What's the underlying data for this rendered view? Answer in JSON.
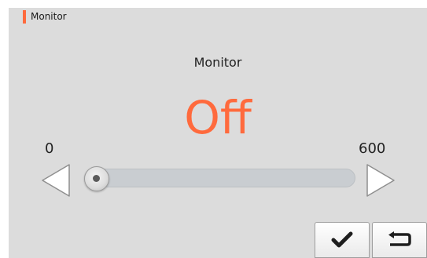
{
  "breadcrumb": {
    "label": "Monitor"
  },
  "setting": {
    "title": "Monitor",
    "value_text": "Off",
    "value_color": "#ff6a3d"
  },
  "slider": {
    "min_label": "0",
    "max_label": "600",
    "min": 0,
    "max": 600,
    "value": 0
  },
  "buttons": {
    "confirm_icon": "check-icon",
    "back_icon": "return-arrow-icon"
  }
}
